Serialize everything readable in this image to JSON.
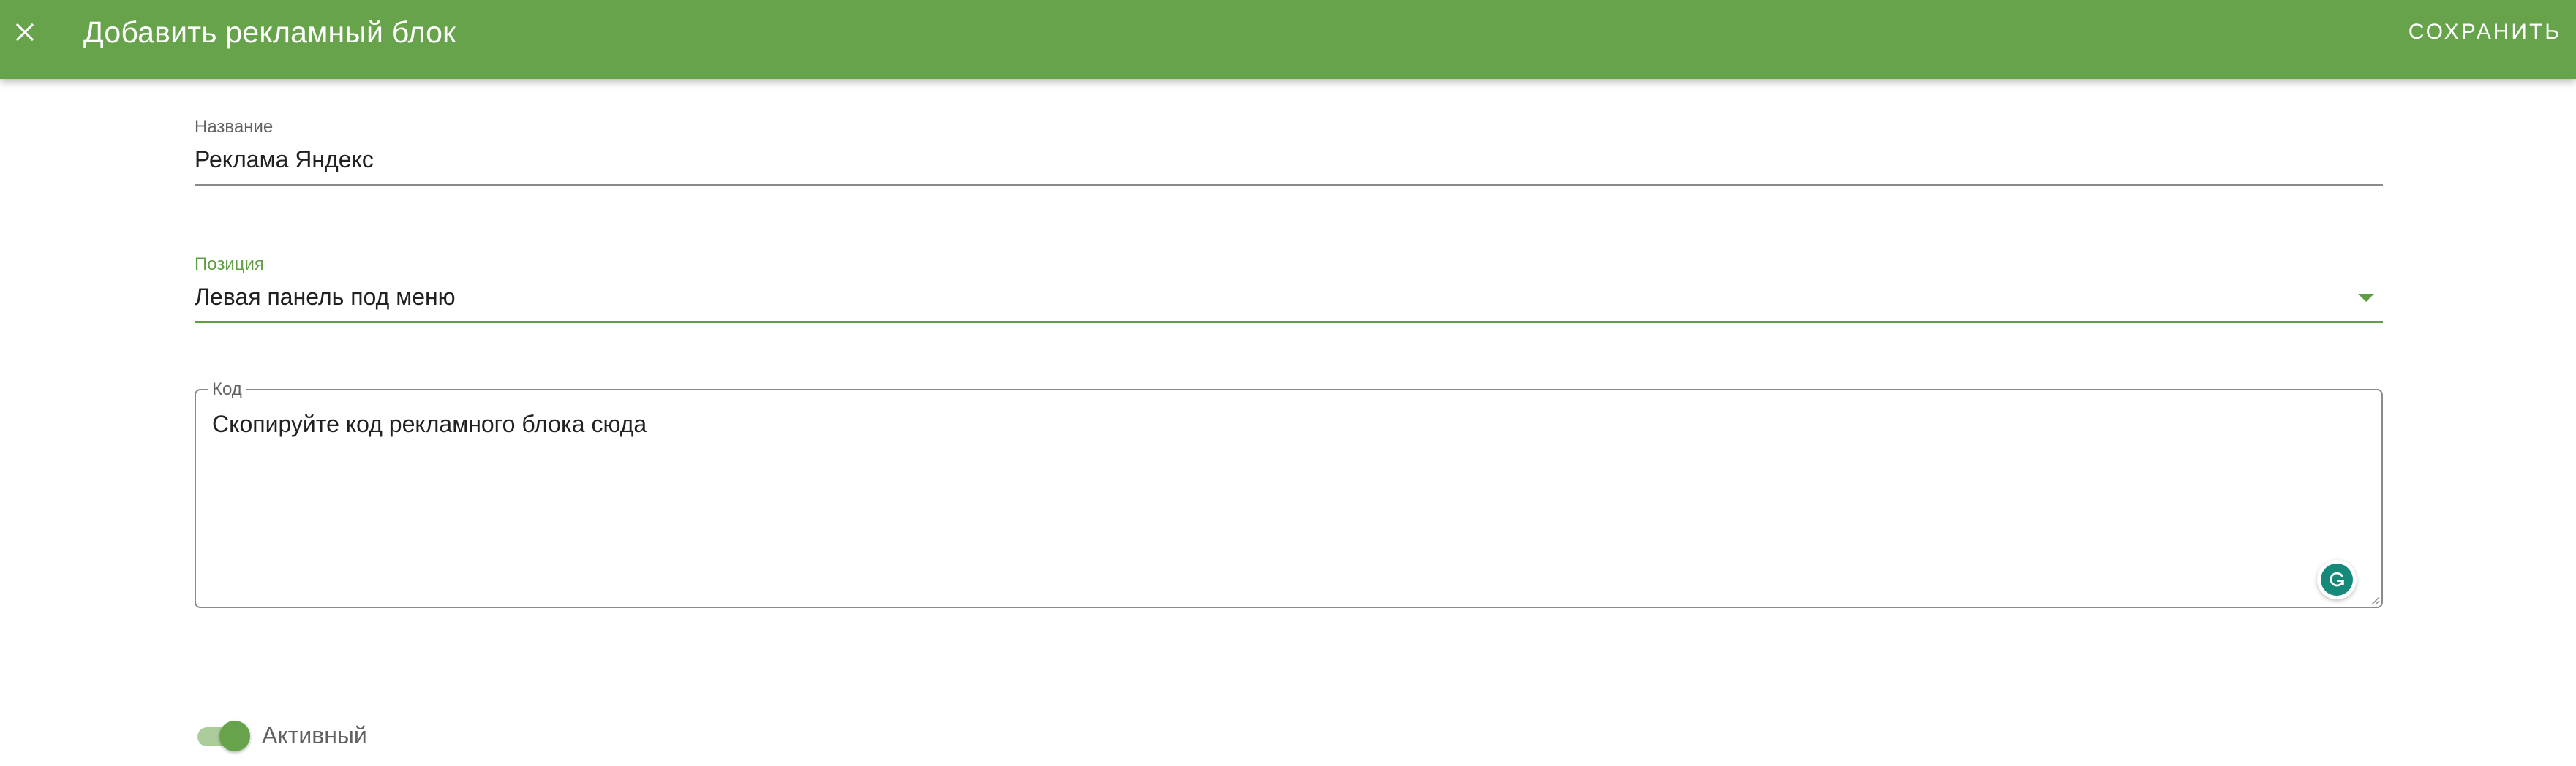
{
  "colors": {
    "app_bar": "#67a34b",
    "accent": "#5f9e43",
    "text_primary": "#212121",
    "text_secondary": "#616161",
    "grammarly": "#15897a"
  },
  "header": {
    "close_icon": "close-icon",
    "title": "Добавить рекламный блок",
    "save_label": "СОХРАНИТЬ"
  },
  "form": {
    "name": {
      "label": "Название",
      "value": "Реклама Яндекс"
    },
    "position": {
      "label": "Позиция",
      "selected": "Левая панель под меню",
      "icon": "dropdown-arrow-icon"
    },
    "code": {
      "label": "Код",
      "placeholder": "Скопируйте код рекламного блока сюда",
      "extension_icon": "grammarly-icon"
    },
    "active": {
      "label": "Активный",
      "checked": true
    }
  }
}
